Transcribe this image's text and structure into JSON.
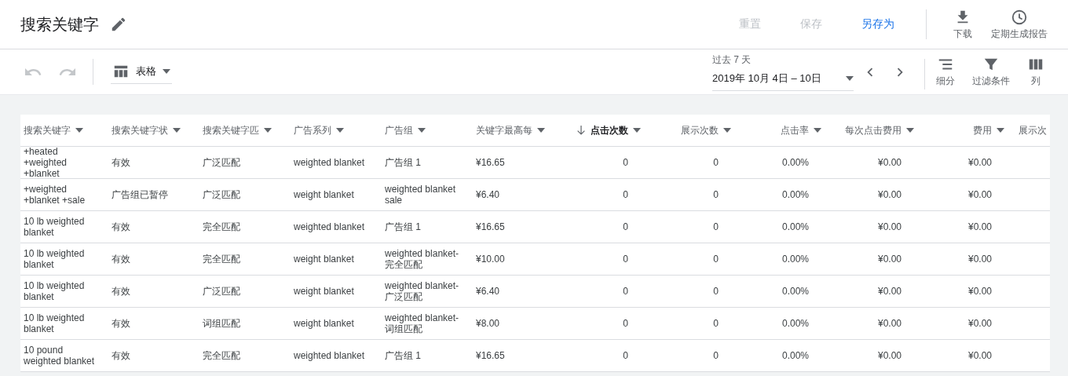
{
  "header": {
    "title": "搜索关键字",
    "actions": [
      {
        "label": "重置",
        "disabled": true
      },
      {
        "label": "保存",
        "disabled": true
      },
      {
        "label": "另存为",
        "disabled": false
      }
    ],
    "tools": [
      {
        "kind": "download",
        "label": "下载"
      },
      {
        "kind": "schedule",
        "label": "定期生成报告"
      }
    ]
  },
  "toolbar": {
    "undo": {
      "disabled": true
    },
    "redo": {
      "disabled": true
    },
    "view": "表格",
    "date_range": {
      "label": "过去 7 天",
      "value": "2019年 10月 4日 – 10日"
    },
    "tools": [
      {
        "kind": "segment",
        "label": "细分"
      },
      {
        "kind": "filter",
        "label": "过滤条件"
      },
      {
        "kind": "columns",
        "label": "列"
      }
    ]
  },
  "table": {
    "columns": [
      {
        "label": "搜索关键字",
        "kind": "text",
        "sorted": false
      },
      {
        "label": "搜索关键字状",
        "kind": "text",
        "sorted": false
      },
      {
        "label": "搜索关键字匹",
        "kind": "text",
        "sorted": false
      },
      {
        "label": "广告系列",
        "kind": "text",
        "sorted": false
      },
      {
        "label": "广告组",
        "kind": "text",
        "sorted": false
      },
      {
        "label": "关键字最高每",
        "kind": "text",
        "sorted": false
      },
      {
        "label": "点击次数",
        "kind": "number",
        "sorted": true
      },
      {
        "label": "展示次数",
        "kind": "number",
        "sorted": false
      },
      {
        "label": "点击率",
        "kind": "number",
        "sorted": false
      },
      {
        "label": "每次点击费用",
        "kind": "number",
        "sorted": false
      },
      {
        "label": "费用",
        "kind": "number",
        "sorted": false
      },
      {
        "label": "展示次",
        "kind": "cut"
      }
    ],
    "rows": [
      [
        "+heated +weighted +blanket",
        "有效",
        "广泛匹配",
        "weighted blanket",
        "广告组 1",
        "¥16.65",
        "0",
        "0",
        "0.00%",
        "¥0.00",
        "¥0.00"
      ],
      [
        "+weighted +blanket +sale",
        "广告组已暂停",
        "广泛匹配",
        "weight blanket",
        "weighted blanket sale",
        "¥6.40",
        "0",
        "0",
        "0.00%",
        "¥0.00",
        "¥0.00"
      ],
      [
        "10 lb weighted blanket",
        "有效",
        "完全匹配",
        "weighted blanket",
        "广告组 1",
        "¥16.65",
        "0",
        "0",
        "0.00%",
        "¥0.00",
        "¥0.00"
      ],
      [
        "10 lb weighted blanket",
        "有效",
        "完全匹配",
        "weight blanket",
        "weighted blanket-完全匹配",
        "¥10.00",
        "0",
        "0",
        "0.00%",
        "¥0.00",
        "¥0.00"
      ],
      [
        "10 lb weighted blanket",
        "有效",
        "广泛匹配",
        "weight blanket",
        "weighted blanket-广泛匹配",
        "¥6.40",
        "0",
        "0",
        "0.00%",
        "¥0.00",
        "¥0.00"
      ],
      [
        "10 lb weighted blanket",
        "有效",
        "词组匹配",
        "weight blanket",
        "weighted blanket-词组匹配",
        "¥8.00",
        "0",
        "0",
        "0.00%",
        "¥0.00",
        "¥0.00"
      ],
      [
        "10 pound weighted blanket",
        "有效",
        "完全匹配",
        "weighted blanket",
        "广告组 1",
        "¥16.65",
        "0",
        "0",
        "0.00%",
        "¥0.00",
        "¥0.00"
      ]
    ]
  }
}
